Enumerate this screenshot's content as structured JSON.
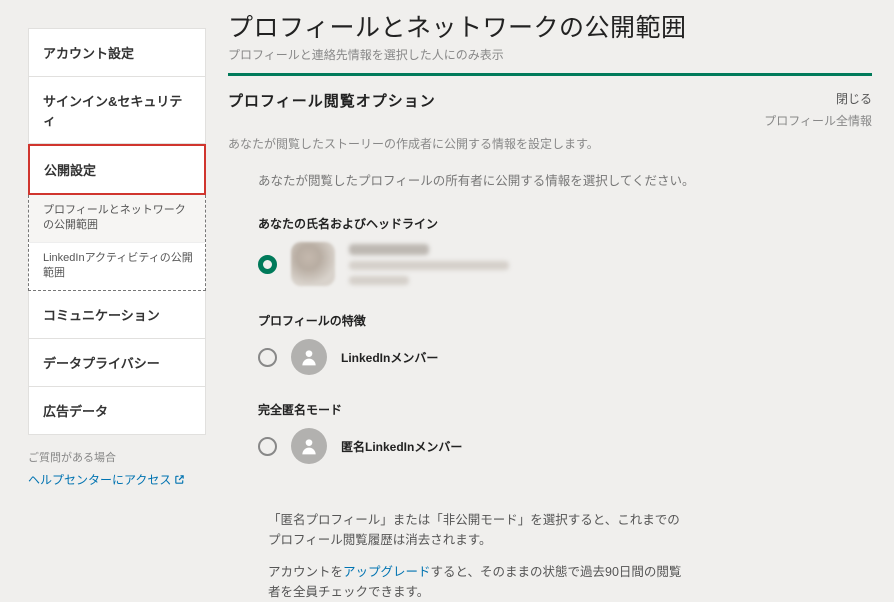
{
  "sidebar": {
    "items": [
      {
        "label": "アカウント設定"
      },
      {
        "label": "サインイン&セキュリティ"
      },
      {
        "label": "公開設定"
      },
      {
        "label": "コミュニケーション"
      },
      {
        "label": "データプライバシー"
      },
      {
        "label": "広告データ"
      }
    ],
    "sub_items": [
      {
        "label": "プロフィールとネットワークの公開範囲"
      },
      {
        "label": "LinkedInアクティビティの公開範囲"
      }
    ],
    "help_note": "ご質問がある場合",
    "help_link": "ヘルプセンターにアクセス"
  },
  "page": {
    "title": "プロフィールとネットワークの公開範囲",
    "subtitle": "プロフィールと連絡先情報を選択した人にのみ表示"
  },
  "section": {
    "title": "プロフィール閲覧オプション",
    "close": "閉じる",
    "more": "プロフィール全情報",
    "desc": "あなたが閲覧したストーリーの作成者に公開する情報を設定します。",
    "instructions": "あなたが閲覧したプロフィールの所有者に公開する情報を選択してください。"
  },
  "options": {
    "a": {
      "title": "あなたの氏名およびヘッドライン"
    },
    "b": {
      "title": "プロフィールの特徴",
      "label": "LinkedInメンバー"
    },
    "c": {
      "title": "完全匿名モード",
      "label": "匿名LinkedInメンバー"
    }
  },
  "notes": {
    "n1": "「匿名プロフィール」または「非公開モード」を選択すると、これまでのプロフィール閲覧履歴は消去されます。",
    "n2a": "アカウントを",
    "n2link": "アップグレード",
    "n2b": "すると、そのままの状態で過去90日間の閲覧者を全員チェックできます。"
  }
}
